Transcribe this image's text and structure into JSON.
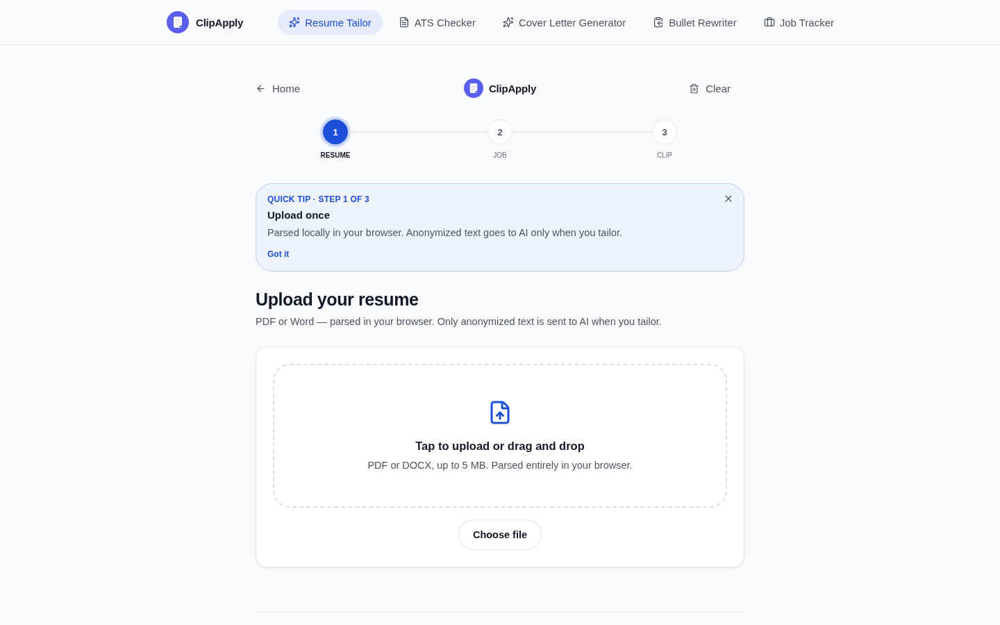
{
  "header": {
    "brand": "ClipApply",
    "nav": [
      {
        "label": "Resume Tailor",
        "selected": true
      },
      {
        "label": "ATS Checker",
        "selected": false
      },
      {
        "label": "Cover Letter Generator",
        "selected": false
      },
      {
        "label": "Bullet Rewriter",
        "selected": false
      },
      {
        "label": "Job Tracker",
        "selected": false
      }
    ]
  },
  "toolbar": {
    "back_link": "Home",
    "brand": "ClipApply",
    "clear_button": "Clear"
  },
  "stepper": {
    "steps": [
      {
        "number": "1",
        "label": "RESUME",
        "selected": true
      },
      {
        "number": "2",
        "label": "JOB",
        "selected": false
      },
      {
        "number": "3",
        "label": "CLIP",
        "selected": false
      }
    ]
  },
  "tip": {
    "eyebrow": "QUICK TIP · STEP 1 OF 3",
    "title": "Upload once",
    "text": "Parsed locally in your browser. Anonymized text goes to AI only when you tailor.",
    "action": "Got it"
  },
  "upload": {
    "heading": "Upload your resume",
    "subheading": "PDF or Word — parsed in your browser. Only anonymized text is sent to AI when you tailor.",
    "dropzone": {
      "title": "Tap to upload or drag and drop",
      "hint": "PDF or DOCX, up to 5 MB. Parsed entirely in your browser."
    },
    "button": "Choose file"
  }
}
